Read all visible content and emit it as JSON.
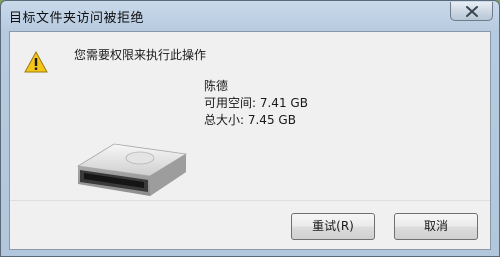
{
  "window": {
    "title": "目标文件夹访问被拒绝"
  },
  "dialog": {
    "message": "您需要权限来执行此操作",
    "drive": {
      "name": "陈德",
      "free_space": "可用空间: 7.41 GB",
      "total_size": "总大小: 7.45 GB",
      "icon": "removable-drive-icon"
    },
    "warning_icon": "warning-icon"
  },
  "buttons": {
    "retry_label": "重试(R)",
    "cancel_label": "取消"
  },
  "colors": {
    "warning_yellow": "#f5c518",
    "title_bar": "#c9d9ea"
  }
}
